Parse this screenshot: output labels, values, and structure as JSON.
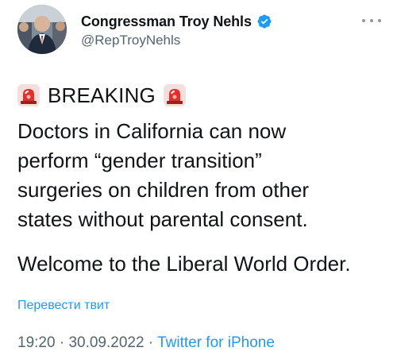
{
  "author": {
    "display_name": "Congressman Troy Nehls",
    "handle": "@RepTroyNehls",
    "verified": true,
    "verified_color": "#1d9bf0"
  },
  "more_icon": "ellipsis-icon",
  "tweet": {
    "breaking_label": "BREAKING",
    "siren_icon": "police-siren-emoji",
    "body_lines": [
      "Doctors in California can now",
      "perform “gender transition”",
      "surgeries on children from other",
      "states without parental consent."
    ],
    "closing_line": "Welcome to the Liberal World Order."
  },
  "translate_label": "Перевести твит",
  "meta": {
    "time": "19:20",
    "separator": " · ",
    "date": "30.09.2022",
    "source": "Twitter for iPhone"
  },
  "colors": {
    "link": "#1d9bf0",
    "secondary": "#536471",
    "text": "#0f1419"
  }
}
